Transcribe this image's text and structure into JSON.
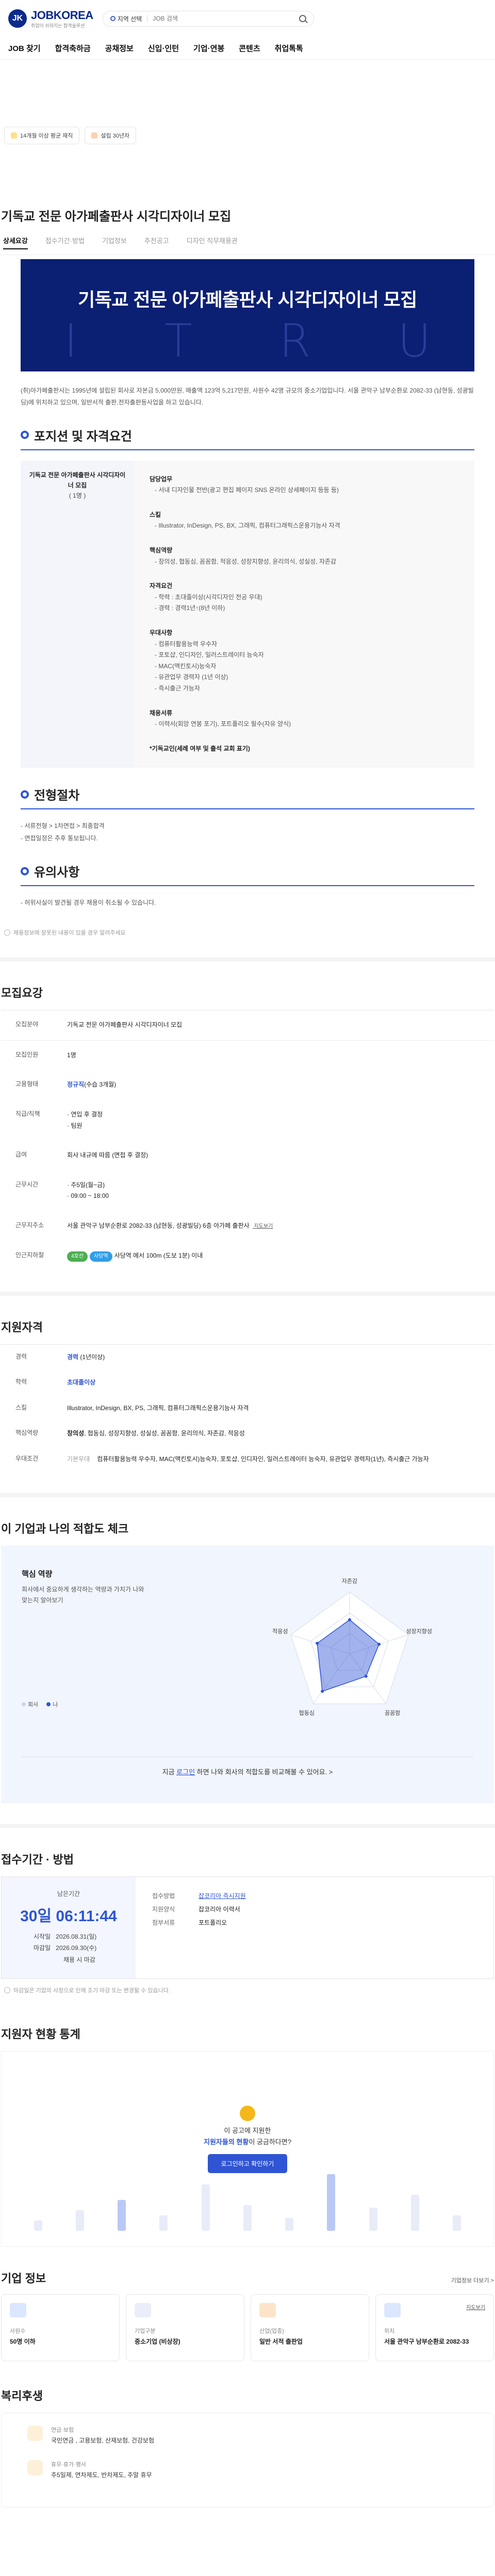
{
  "header": {
    "logo_badge": "JK",
    "logo_text": "JOBKOREA",
    "logo_sub": "취업이 쉬워지는 합격솔루션",
    "region_label": "지역 선택",
    "search_placeholder": "JOB 검색"
  },
  "nav": [
    "JOB 찾기",
    "합격축하금",
    "공채정보",
    "신입·인턴",
    "기업·연봉",
    "콘텐츠",
    "취업톡톡"
  ],
  "chips": [
    "14개월 이상 평균 재직",
    "설립 30년차"
  ],
  "job": {
    "title": "기독교 전문 아가페출판사 시각디자이너 모집",
    "tabs": [
      "상세요강",
      "접수기간·방법",
      "기업정보",
      "추천공고",
      "디자인 직무채용관"
    ],
    "banner_title": "기독교 전문 아가페출판사 시각디자이너 모집",
    "banner_deco": [
      "I",
      "T",
      "R",
      "U"
    ],
    "intro": "(취)아가페출판사는 1995년에 설립된 회사로 자본금 5,000만원, 매출액 123억 5,217만원, 사원수 42명 규모의 중소기업입니다. 서울 관악구 남부순환로 2082-33 (남현동, 성광빌딩)에 위치하고 있으며, 일반서적 출판,전자출판등사업을 하고 있습니다."
  },
  "position": {
    "heading": "포지션 및 자격요건",
    "left_title": "기독교 전문 아가페출판사 시각디자이너 모집",
    "left_count": "( 1명 )",
    "groups": [
      {
        "title": "담당업무",
        "lines": [
          "- 서내 디자인물 전반(광고 편집 페이지 SNS 온라인 상세페이지 등등 등)"
        ]
      },
      {
        "title": "스킬",
        "lines": [
          "- Illustrator, InDesign, PS, BX, 그래픽, 컴퓨터그래픽스운용기능사 자격"
        ]
      },
      {
        "title": "핵심역량",
        "lines": [
          "- 창의성, 협동심, 꼼꼼함, 적응성, 성장지향성, 윤리의식, 성실성, 자존감"
        ]
      },
      {
        "title": "자격요건",
        "lines": [
          "- 학력 : 초대졸이상(시각디자인 전공 우대)",
          "- 경력 : 경력1년↑(8년 이하)"
        ]
      },
      {
        "title": "우대사항",
        "lines": [
          "- 컴퓨터활용능력 우수자",
          "- 포토샵, 인디자인, 일러스트레이터 능숙자",
          "- MAC(맥킨토시)능숙자",
          "- 유관업무 경력자 (1년 이상)",
          "- 즉시출근 가능자"
        ]
      },
      {
        "title": "채용서류",
        "lines": [
          "- 이력서(회망 연봉 포기), 포트폴리오 필수(자유 양식)"
        ]
      }
    ],
    "footer_strong": "*기독교인(세례 여부 및 출석 교회 표기)"
  },
  "process": {
    "heading": "전형절차",
    "lines": [
      "- 서류전형 > 1차면접 > 최종합격",
      "- 면접일정은 추후 통보됩니다."
    ]
  },
  "caution": {
    "heading": "유의사항",
    "lines": [
      "- 허위사실이 발견될 경우 채용이 취소될 수 있습니다."
    ]
  },
  "report_note": "채용정보에 잘못된 내용이 있을 경우 알려주세요",
  "recruit": {
    "heading": "모집요강",
    "rows": [
      {
        "k": "모집분야",
        "v": "기독교 전문 아가페출판사 시각디자이너 모집"
      },
      {
        "k": "모집인원",
        "v": "1명"
      },
      {
        "k": "고용형태",
        "v": "정규직",
        "v2": "(수습 3개월)"
      },
      {
        "k": "직급/직책",
        "v": "· 연입 후 결정\n· 팀원"
      },
      {
        "k": "급여",
        "v": "회사 내규에 따름 (면접 후 결정)"
      },
      {
        "k": "근무시간",
        "v": "· 주5일(월~금)\n· 09:00 ~ 18:00"
      },
      {
        "k": "근무지주소",
        "v": "서울 관악구 남부순환로 2082-33 (남현동, 성광빌딩) 6층 아가페 출판사",
        "link": "지도보기"
      },
      {
        "k": "인근지하철",
        "badges": [
          "4호선",
          "사당역"
        ],
        "v": "사당역 에서 100m (도보 1분) 이내"
      }
    ]
  },
  "applicant": {
    "heading": "지원자격",
    "rows": [
      {
        "k": "경력",
        "v": "경력",
        "v2": "(1년이상)"
      },
      {
        "k": "학력",
        "v": "초대졸이상"
      },
      {
        "k": "스킬",
        "v": "Illustrator, InDesign, BX, PS, 그래픽, 컴퓨터그래픽스운용기능사 자격"
      },
      {
        "k": "핵심역량",
        "v": "창의성, 협동심, 성장지향성, 성실성, 꼼꼼함, 윤리의식, 자존감, 적응성"
      },
      {
        "k": "우대조건",
        "pre": "기본우대",
        "v": "컴퓨터활용능력 우수자, MAC(맥킨토시)능숙자, 포토샵, 인디자인, 일러스트레이터 능숙자, 유관업무 경력자(1년), 즉시출근 가능자"
      }
    ]
  },
  "fit": {
    "heading": "이 기업과 나의 적합도 체크",
    "card_title": "핵심 역량",
    "card_desc": "회사에서 중요하게 생각하는 역량과 가치가 나와 맞는지 알아보기",
    "legend": [
      "회사",
      "나"
    ],
    "axes": [
      "자존감",
      "성장지향성",
      "꼼꼼함",
      "협동심",
      "적응성"
    ],
    "values": [
      0.55,
      0.5,
      0.45,
      0.75,
      0.55
    ],
    "footer_pre": "지금 ",
    "footer_link": "로그인",
    "footer_post": " 하면 나와 회사의 적합도를 비교해볼 수 있어요. >"
  },
  "deadline": {
    "heading": "접수기간 · 방법",
    "label": "남은기간",
    "time": "30일 06:11:44",
    "rows": [
      {
        "k": "시작일",
        "v": "2026.08.31(일)"
      },
      {
        "k": "마감일",
        "v": "2026.09.30(수)"
      },
      {
        "k": "",
        "v": "채용 시 마감"
      }
    ],
    "info": [
      {
        "k": "접수방법",
        "v": "잡코리아 즉시지원",
        "link": true
      },
      {
        "k": "지원양식",
        "v": "잡코리아 이력서"
      },
      {
        "k": "첨부서류",
        "v": "포트폴리오"
      }
    ],
    "note": "마감일은 기업의 사정으로 인해 조기 마감 또는 변경될 수 있습니다."
  },
  "stats": {
    "heading": "지원자 현황 통계",
    "line1": "이 공고에 지원한",
    "line2_pre": "지원자들의 현황",
    "line2_post": "이 궁금하다면?",
    "button": "로그인하고 확인하기"
  },
  "company": {
    "heading": "기업 정보",
    "more": "기업정보 더보기 >",
    "cards": [
      {
        "k": "사원수",
        "v": "50명 이하",
        "color": "#dbe6ff"
      },
      {
        "k": "기업구분",
        "v": "중소기업 (비상장)",
        "color": "#e9eef9"
      },
      {
        "k": "산업(업종)",
        "v": "일반 서적 출판업",
        "color": "#fde4c9"
      },
      {
        "k": "위치",
        "v": "서울 관악구 남부순환로 2082-33",
        "color": "#dbe6ff",
        "link": "지도보기"
      }
    ]
  },
  "welfare": {
    "heading": "복리후생",
    "items": [
      {
        "k": "연금·보험",
        "v": "국민연금 , 고용보험, 산재보험, 건강보험"
      },
      {
        "k": "휴무·휴가·행사",
        "v": "주5일제, 연차제도, 반차제도, 주말 휴무"
      }
    ]
  }
}
